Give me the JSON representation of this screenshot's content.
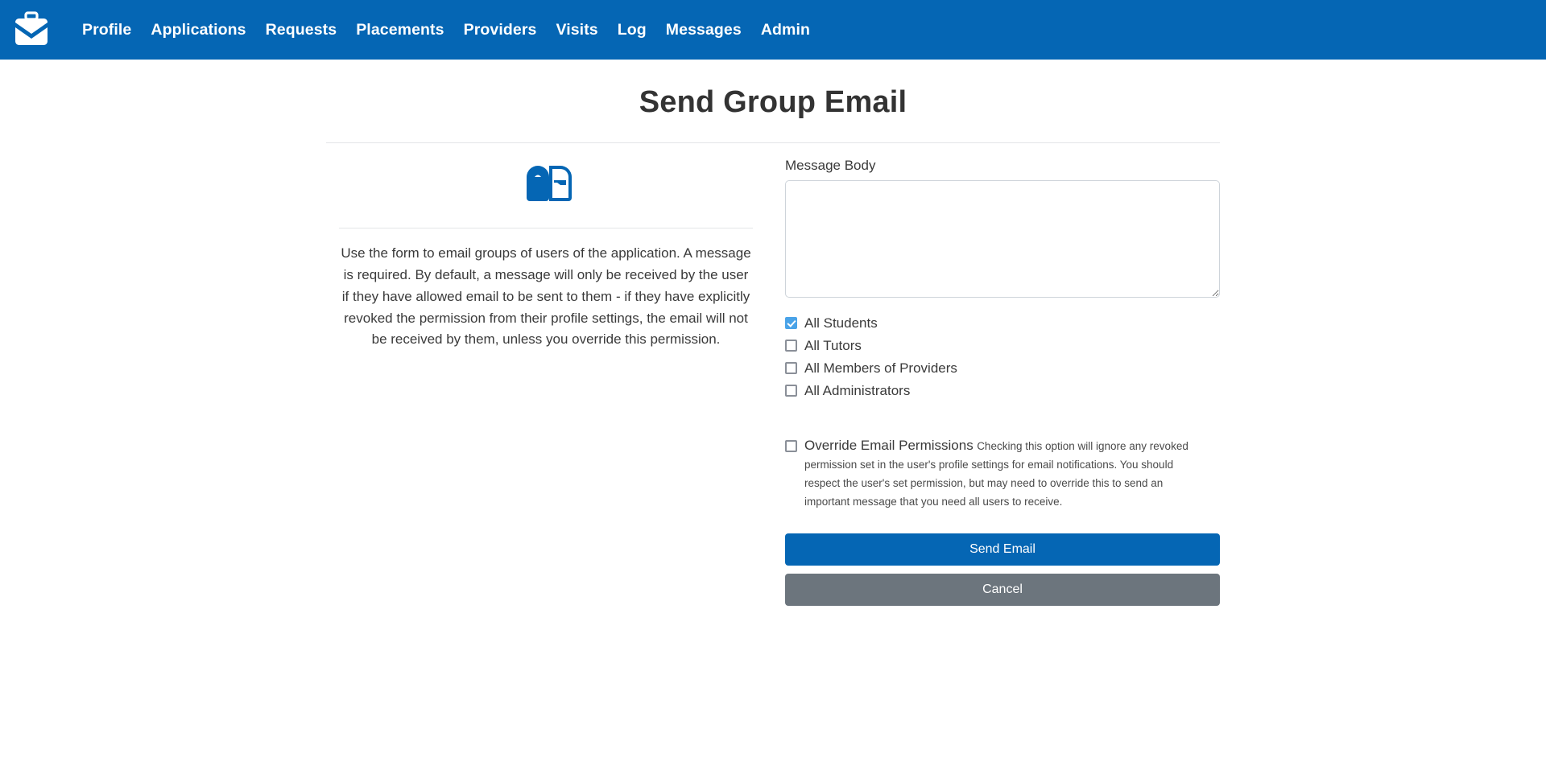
{
  "navbar": {
    "brand_icon": "briefcase-icon",
    "links": [
      {
        "label": "Profile"
      },
      {
        "label": "Applications"
      },
      {
        "label": "Requests"
      },
      {
        "label": "Placements"
      },
      {
        "label": "Providers"
      },
      {
        "label": "Visits"
      },
      {
        "label": "Log"
      },
      {
        "label": "Messages"
      },
      {
        "label": "Admin"
      }
    ]
  },
  "page": {
    "title": "Send Group Email"
  },
  "left": {
    "illustration_icon": "mailbox-icon",
    "help_text": "Use the form to email groups of users of the application. A message is required. By default, a message will only be received by the user if they have allowed email to be sent to them - if they have explicitly revoked the permission from their profile settings, the email will not be received by them, unless you override this permission."
  },
  "form": {
    "message_label": "Message Body",
    "message_value": "",
    "message_placeholder": "",
    "recipients": [
      {
        "label": "All Students",
        "checked": true
      },
      {
        "label": "All Tutors",
        "checked": false
      },
      {
        "label": "All Members of Providers",
        "checked": false
      },
      {
        "label": "All Administrators",
        "checked": false
      }
    ],
    "override": {
      "label": "Override Email Permissions",
      "checked": false,
      "help": "Checking this option will ignore any revoked permission set in the user's profile settings for email notifications. You should respect the user's set permission, but may need to override this to send an important message that you need all users to receive."
    },
    "submit_label": "Send Email",
    "cancel_label": "Cancel"
  },
  "colors": {
    "brand_blue": "#0566b4",
    "cancel_gray": "#6c757d",
    "checkbox_blue": "#4aa3e8",
    "rule_gray": "#e3e5e8"
  }
}
